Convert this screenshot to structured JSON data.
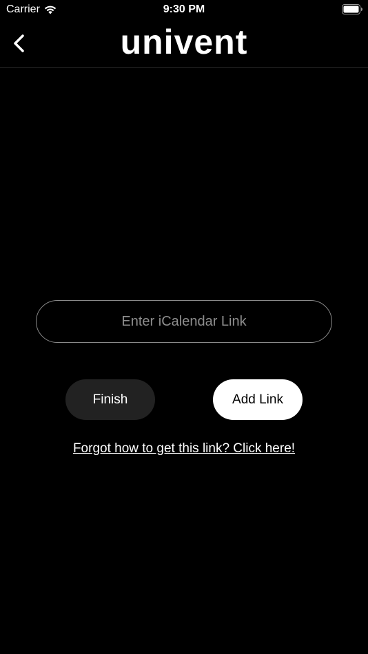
{
  "status_bar": {
    "carrier": "Carrier",
    "time": "9:30 PM",
    "wifi_icon": "wifi-icon",
    "battery_icon": "battery-icon"
  },
  "nav": {
    "title": "univent",
    "back_icon": "chevron-left-icon"
  },
  "form": {
    "link_input": {
      "placeholder": "Enter iCalendar Link",
      "value": ""
    },
    "finish_label": "Finish",
    "add_link_label": "Add Link",
    "help_link_text": "Forgot how to get this link? Click here!"
  },
  "colors": {
    "background": "#000000",
    "text": "#ffffff",
    "finish_button_bg": "#222222",
    "add_link_button_bg": "#ffffff",
    "input_border": "#8a8a8a",
    "placeholder": "#8e8e8e"
  }
}
